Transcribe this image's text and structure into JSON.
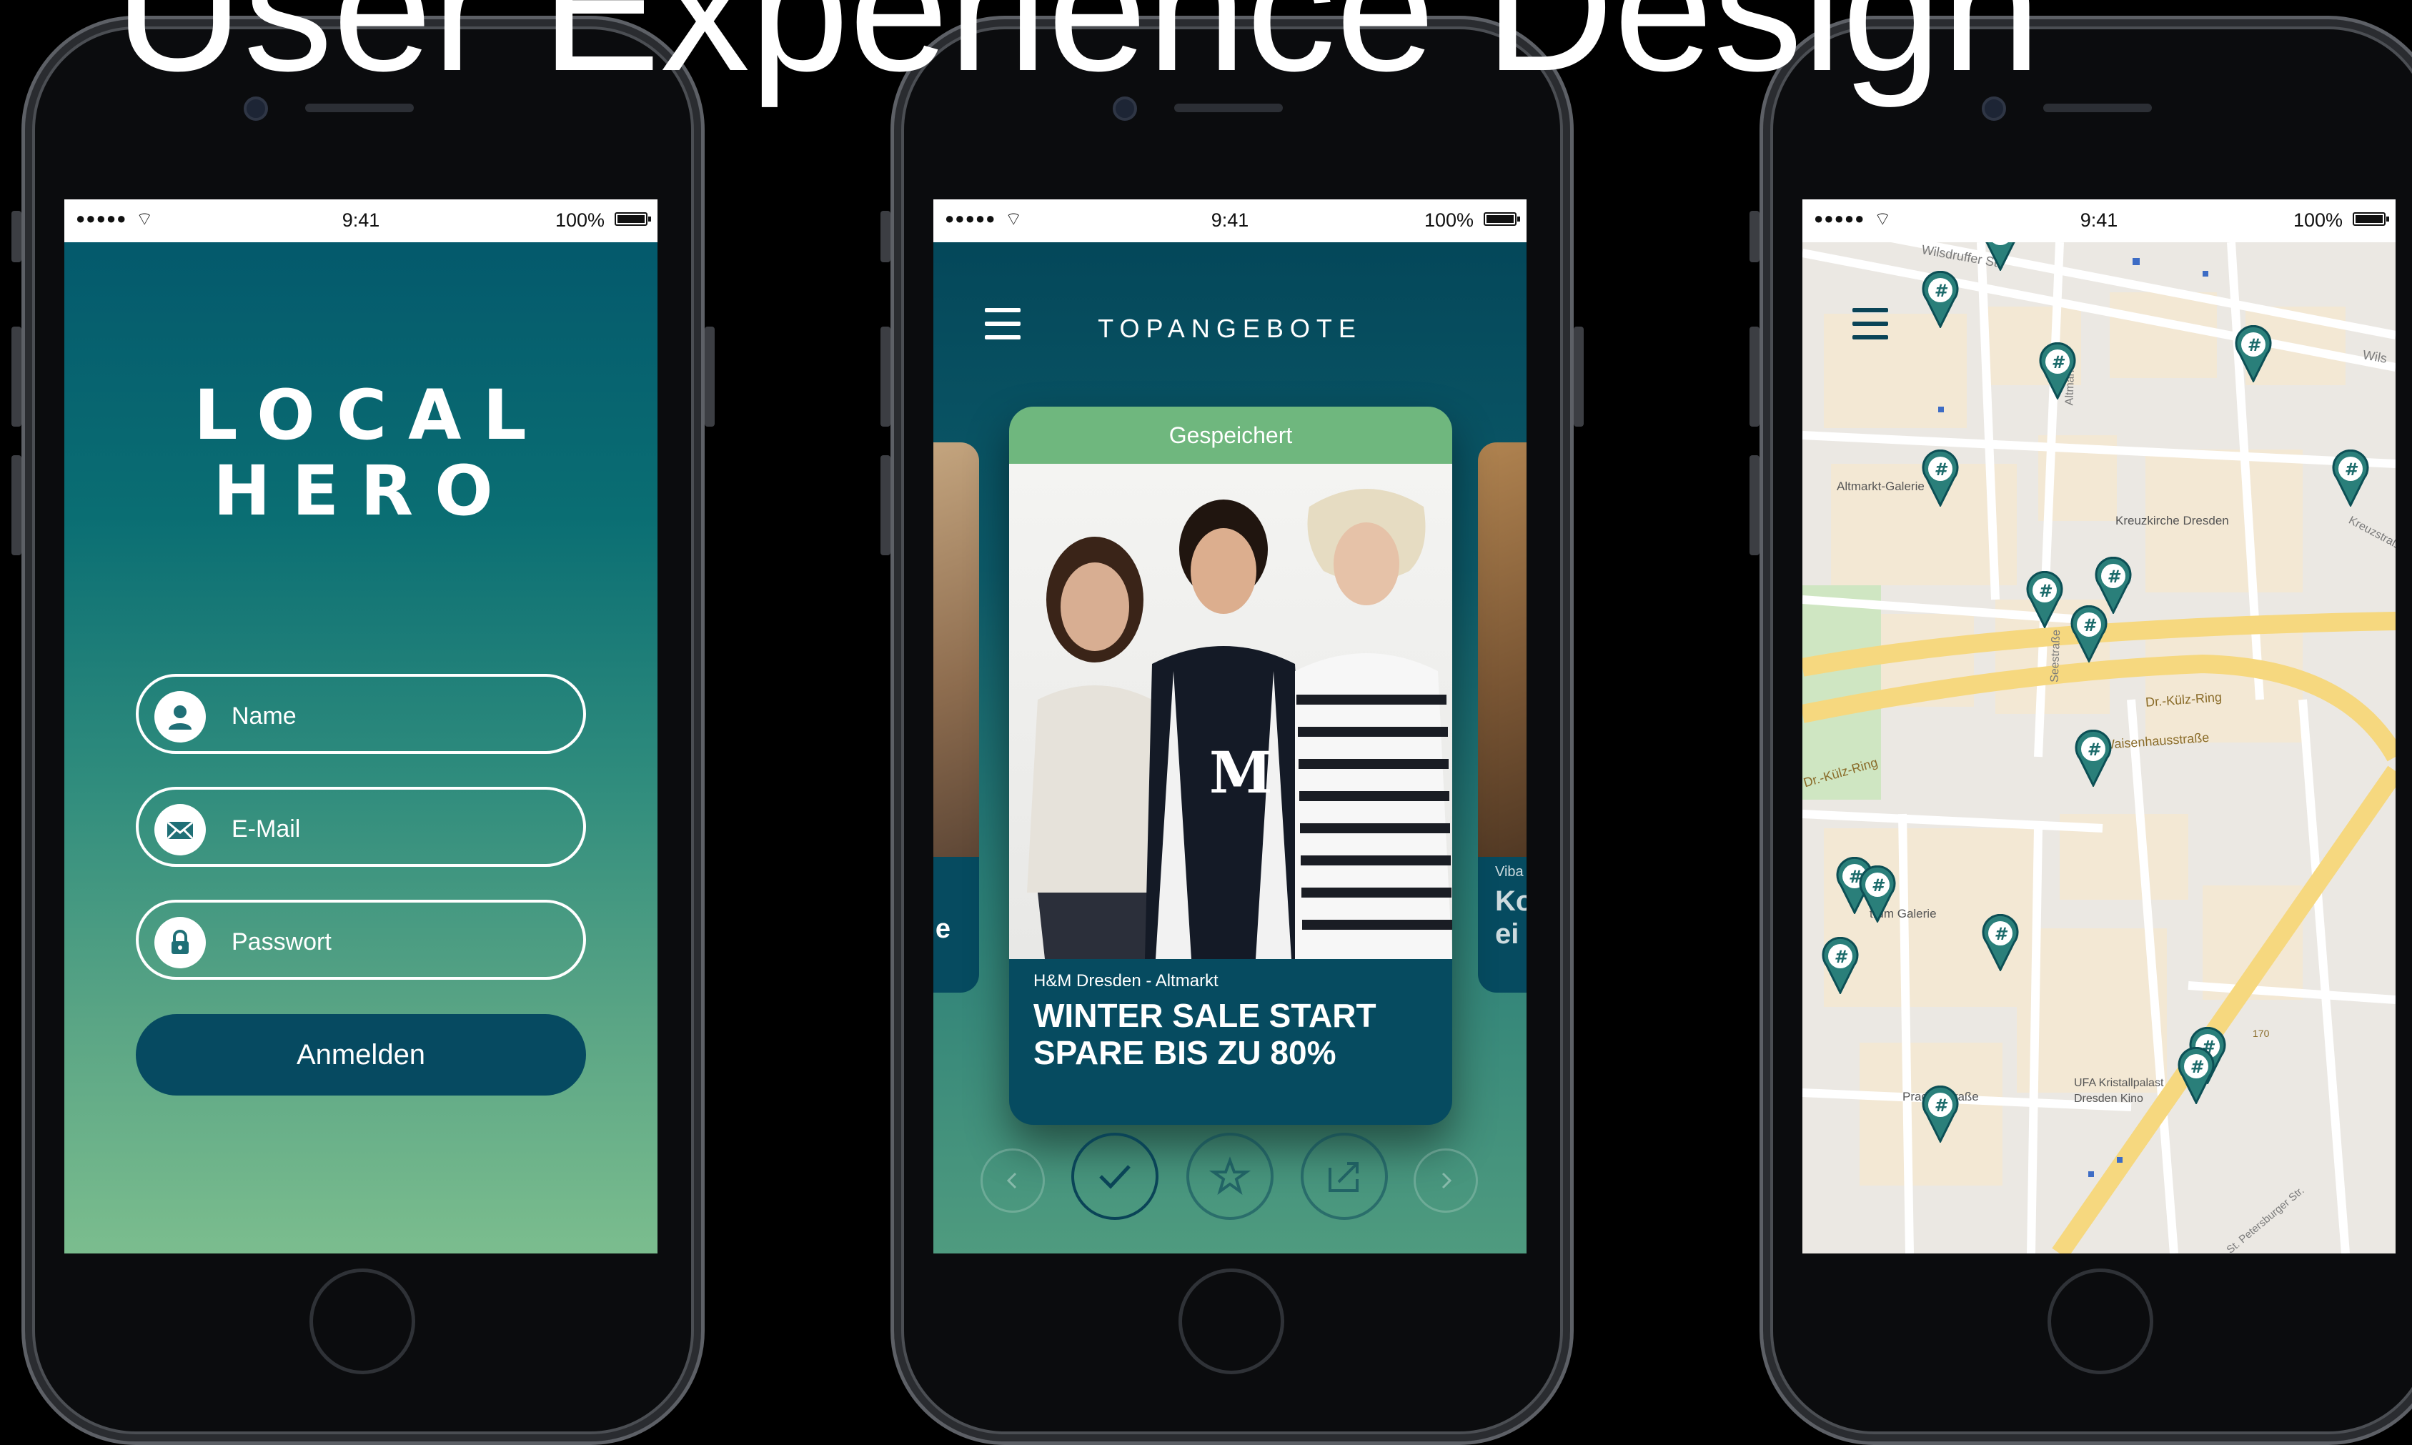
{
  "headline": "User Experience Design",
  "status_bar": {
    "signal": "●●●●●",
    "time": "9:41",
    "battery": "100%"
  },
  "phone1": {
    "logo_line1": "LOCAL",
    "logo_line2": "HERO",
    "fields": [
      {
        "label": "Name",
        "icon": "user-icon"
      },
      {
        "label": "E-Mail",
        "icon": "mail-icon"
      },
      {
        "label": "Passwort",
        "icon": "lock-icon"
      }
    ],
    "login_label": "Anmelden"
  },
  "phone2": {
    "title": "TOPANGEBOTE",
    "card_tag": "Gespeichert",
    "card_store": "H&M Dresden - Altmarkt",
    "card_line1": "WINTER SALE START",
    "card_line2": "SPARE BIS ZU 80%",
    "left_card_text": "e",
    "right_card_small": "Viba",
    "right_card_line1": "Ko",
    "right_card_line2": "ei",
    "actions": [
      "previous-icon",
      "check-icon",
      "star-icon",
      "share-icon",
      "next-icon"
    ]
  },
  "phone3": {
    "map_labels": {
      "altmarkt": "Altmarkt-Galerie",
      "kreuzkirche": "Kreuzkirche Dresden",
      "kuelz1": "Dr.-Külz-Ring",
      "kuelz2": "Dr.-Külz-Ring",
      "waisenhaus": "Waisenhausstraße",
      "centrum": "trum Galerie",
      "prager": "Prager Straße",
      "ufa1": "UFA Kristallpalast",
      "ufa2": "Dresden Kino",
      "wilsdruffer": "Wilsdruffer Str.",
      "altmarkt_street": "Altmarkt",
      "seestrasse": "Seestraße",
      "road_170": "170",
      "wilsdruffer_right": "Wils",
      "kreuzstrasse": "Kreuzstraße",
      "st_petersburger": "St. Petersburger Str."
    },
    "pin_count": 17
  }
}
